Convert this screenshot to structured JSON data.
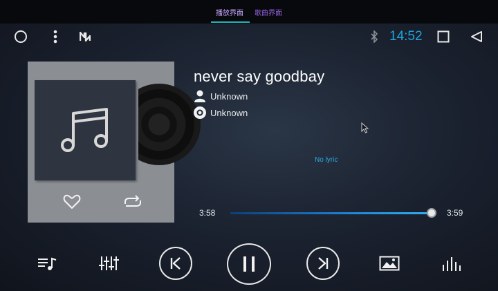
{
  "tabs": [
    {
      "label": "播放界面",
      "active": true
    },
    {
      "label": "歌曲界面",
      "active": false
    }
  ],
  "status": {
    "time": "14:52",
    "icons": [
      "circle-home-icon",
      "more-vert-icon",
      "n-logo-icon",
      "bluetooth-icon",
      "recents-square-icon",
      "back-triangle-icon"
    ]
  },
  "song": {
    "title": "never say goodbay",
    "artist": "Unknown",
    "album": "Unknown"
  },
  "lyric": {
    "text": "No lyric"
  },
  "progress": {
    "elapsed": "3:58",
    "total": "3:59",
    "fraction": 0.996
  },
  "controls": {
    "icons": [
      "playlist-icon",
      "equalizer-icon",
      "previous-icon",
      "pause-icon",
      "next-icon",
      "gallery-icon",
      "spectrum-icon"
    ]
  },
  "colors": {
    "accent_blue": "#1ea5dc",
    "tab_purple": "#8f5fd6",
    "tab_underline": "#1fb6b9",
    "cover_panel": "#8b8f94"
  }
}
